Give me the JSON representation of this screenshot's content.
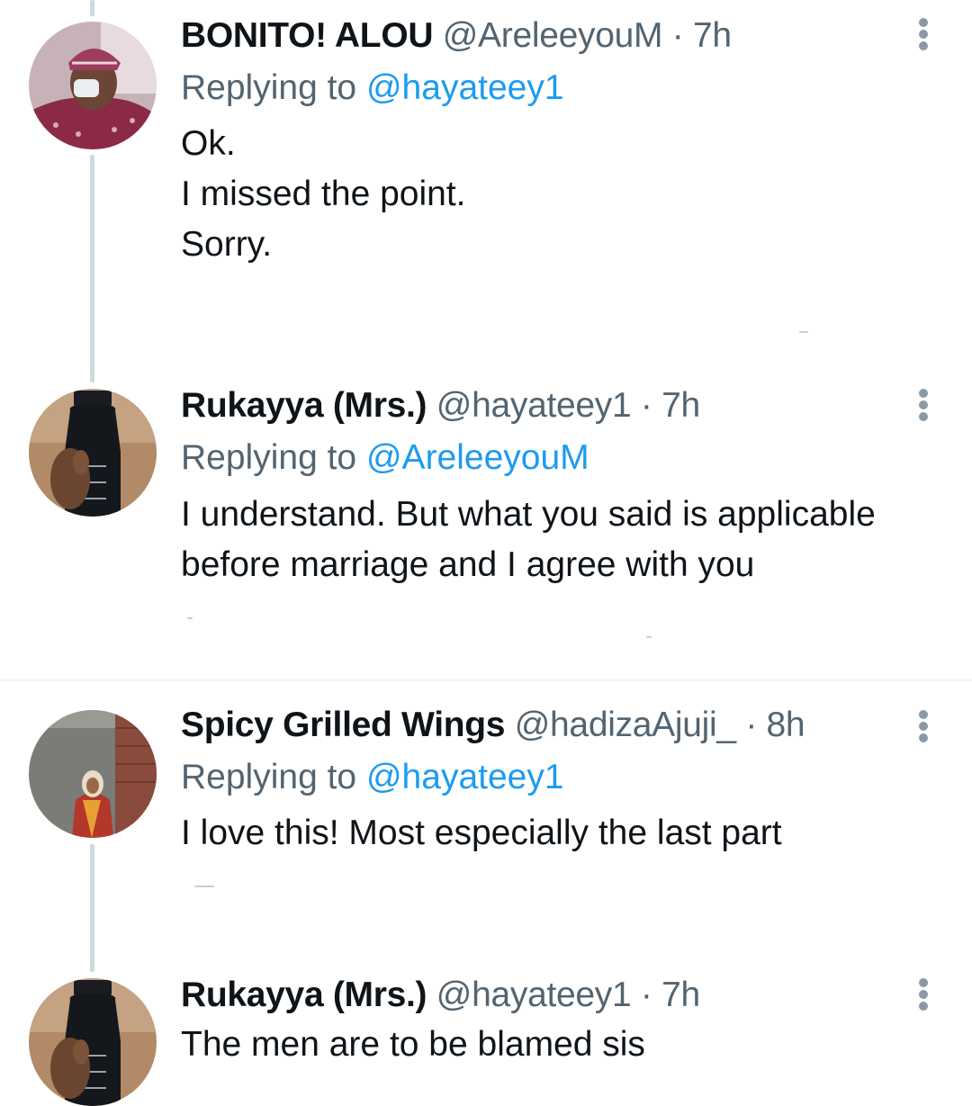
{
  "tweets": [
    {
      "name": "BONITO! ALOU",
      "handle": "@AreleeyouM",
      "separator": "·",
      "time": "7h",
      "replying_prefix": "Replying to",
      "replying_to": "@hayateey1",
      "text_lines": [
        "Ok.",
        "I missed the point.",
        "Sorry."
      ]
    },
    {
      "name": "Rukayya (Mrs.)",
      "handle": "@hayateey1",
      "separator": "·",
      "time": "7h",
      "replying_prefix": "Replying to",
      "replying_to": "@AreleeyouM",
      "text_lines": [
        "I understand. But what you said is applicable",
        "before marriage and I agree with you"
      ]
    },
    {
      "name": "Spicy Grilled Wings",
      "handle": "@hadizaAjuji_",
      "separator": "·",
      "time": "8h",
      "replying_prefix": "Replying to",
      "replying_to": "@hayateey1",
      "text_lines": [
        "I love this! Most especially the last part"
      ]
    },
    {
      "name": "Rukayya (Mrs.)",
      "handle": "@hayateey1",
      "separator": "·",
      "time": "7h",
      "text_lines": [
        "The men are to be blamed sis"
      ]
    }
  ],
  "icons": {
    "more": "more-vertical-icon"
  },
  "colors": {
    "link": "#1d9bf0",
    "secondary_text": "#536471",
    "primary_text": "#0f1419",
    "thread_line": "#cfd9de"
  }
}
